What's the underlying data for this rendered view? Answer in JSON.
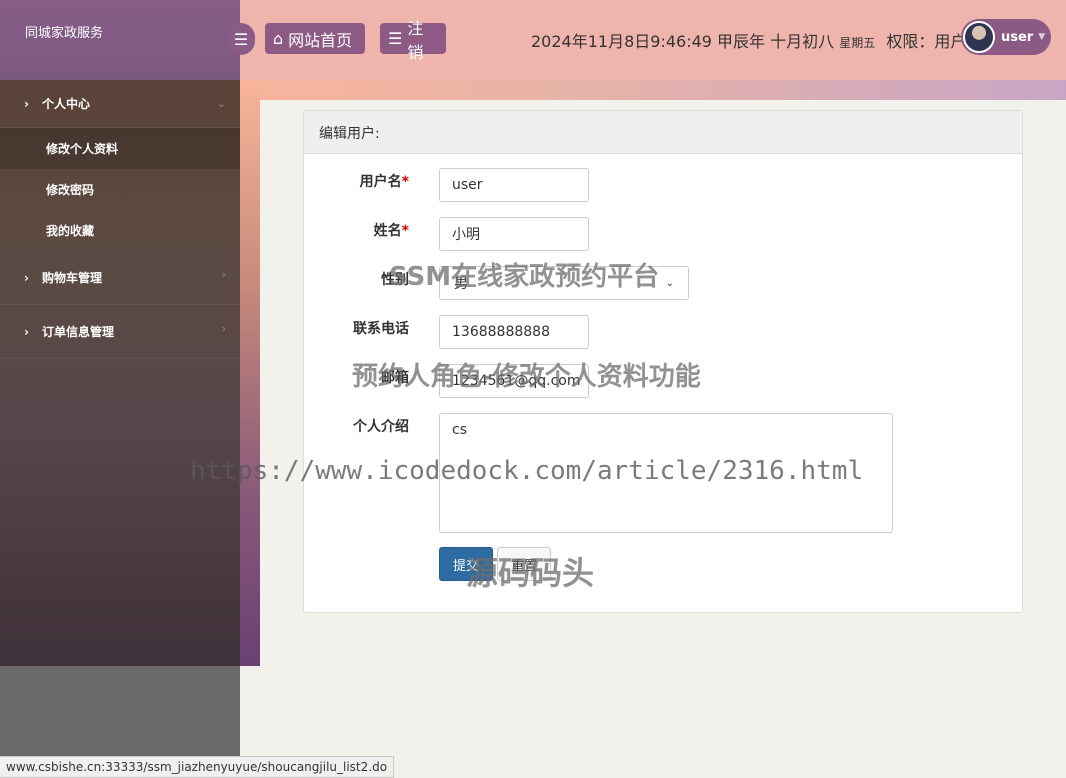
{
  "brand": "同城家政服务",
  "header": {
    "home_label": "网站首页",
    "logout_label": "注销",
    "datetime": "2024年11月8日9:46:49 甲辰年 十月初八",
    "weekday": "星期五",
    "permission": "权限：用户",
    "user_name": "user"
  },
  "sidebar": {
    "groups": [
      {
        "label": "个人中心",
        "items": [
          "修改个人资料",
          "修改密码",
          "我的收藏"
        ]
      },
      {
        "label": "购物车管理"
      },
      {
        "label": "订单信息管理"
      }
    ]
  },
  "form": {
    "title": "编辑用户:",
    "username_label": "用户名",
    "username_value": "user",
    "name_label": "姓名",
    "name_value": "小明",
    "gender_label": "性别",
    "gender_value": "男",
    "phone_label": "联系电话",
    "phone_value": "13688888888",
    "email_label": "邮箱",
    "email_value": "1234561@qq.com",
    "intro_label": "个人介绍",
    "intro_value": "cs",
    "submit_label": "提交",
    "reset_label": "重置"
  },
  "watermarks": {
    "line1": "SSM在线家政预约平台",
    "line2": "预约人角色-修改个人资料功能",
    "line3": "https://www.icodedock.com/article/2316.html",
    "line4": "源码码头"
  },
  "statusbar": "www.csbishe.cn:33333/ssm_jiazhenyuyue/shoucangjilu_list2.do",
  "icons": {
    "menu_toggle": "bars-icon",
    "home": "home-icon",
    "logout": "list-icon",
    "expand": "chevron-right-icon",
    "collapse": "chevron-down-icon"
  }
}
